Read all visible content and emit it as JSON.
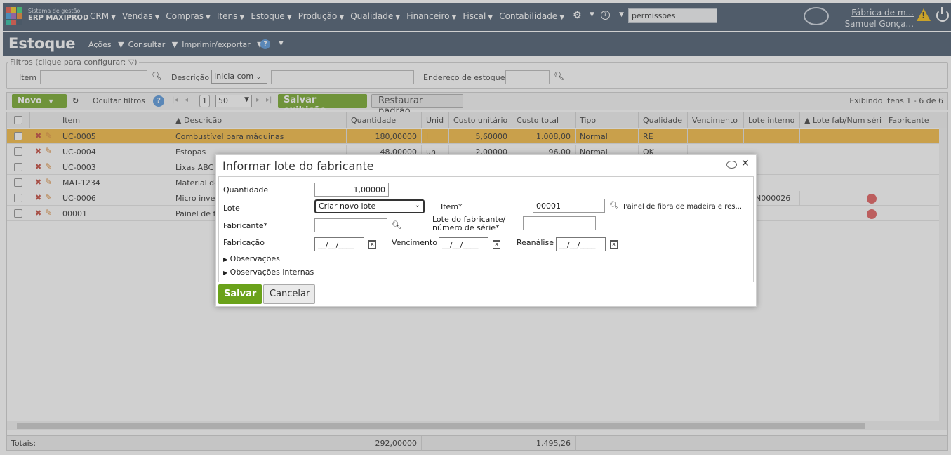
{
  "topbar": {
    "brand_line1": "Sistema de gestão",
    "brand_line2": "ERP MAXIPROD",
    "menu": [
      "CRM",
      "Vendas",
      "Compras",
      "Itens",
      "Estoque",
      "Produção",
      "Qualidade",
      "Financeiro",
      "Fiscal",
      "Contabilidade"
    ],
    "search_value": "permissões",
    "company": "Fábrica de m...",
    "user": "Samuel Gonça..."
  },
  "titlebar": {
    "title": "Estoque",
    "menu": [
      "Ações",
      "Consultar",
      "Imprimir/exportar"
    ]
  },
  "filters": {
    "legend": "Filtros (clique para configurar:",
    "item_label": "Item",
    "descricao_label": "Descrição",
    "descricao_mode": "Inicia com",
    "endereco_label": "Endereço de estoque"
  },
  "toolbar": {
    "novo": "Novo",
    "ocultar_filtros": "Ocultar filtros",
    "page_number": "1",
    "page_size": "50",
    "salvar_exibicao": "Salvar exibição",
    "restaurar_padrao": "Restaurar padrão",
    "exibindo": "Exibindo itens 1 - 6 de 6"
  },
  "grid": {
    "columns": [
      "Item",
      "Descrição",
      "Quantidade",
      "Unid",
      "Custo unitário",
      "Custo total",
      "Tipo",
      "Qualidade",
      "Vencimento",
      "Lote interno",
      "Lote fab/Num séri",
      "Fabricante"
    ],
    "rows": [
      {
        "item": "UC-0005",
        "descricao": "Combustível para máquinas",
        "quantidade": "180,00000",
        "unid": "l",
        "custo_unitario": "5,60000",
        "custo_total": "1.008,00",
        "tipo": "Normal",
        "qualidade": "RE",
        "lote_interno": "",
        "selected": true
      },
      {
        "item": "UC-0004",
        "descricao": "Estopas",
        "quantidade": "48,00000",
        "unid": "un",
        "custo_unitario": "2,00000",
        "custo_total": "96,00",
        "tipo": "Normal",
        "qualidade": "OK",
        "lote_interno": ""
      },
      {
        "item": "UC-0003",
        "descricao": "Lixas ABC",
        "quantidade": "",
        "unid": "",
        "custo_unitario": "",
        "custo_total": "",
        "tipo": "",
        "qualidade": "",
        "lote_interno": ""
      },
      {
        "item": "MAT-1234",
        "descricao": "Material de",
        "quantidade": "",
        "unid": "",
        "custo_unitario": "",
        "custo_total": "",
        "tipo": "",
        "qualidade": "",
        "lote_interno": ""
      },
      {
        "item": "UC-0006",
        "descricao": "Micro inver",
        "quantidade": "",
        "unid": "",
        "custo_unitario": "",
        "custo_total": "",
        "tipo": "",
        "qualidade": "",
        "lote_interno": "N000026"
      },
      {
        "item": "00001",
        "descricao": "Painel de f",
        "quantidade": "",
        "unid": "",
        "custo_unitario": "",
        "custo_total": "",
        "tipo": "",
        "qualidade": "",
        "lote_interno": ""
      }
    ],
    "totals_label": "Totais:",
    "total_quantidade": "292,00000",
    "total_custo": "1.495,26"
  },
  "dialog": {
    "title": "Informar lote do fabricante",
    "quantidade_label": "Quantidade",
    "quantidade_value": "1,00000",
    "lote_label": "Lote",
    "lote_value": "Criar novo lote",
    "item_label": "Item*",
    "item_value": "00001",
    "item_desc": "Painel de fibra de madeira e res...",
    "fabricante_label": "Fabricante*",
    "lote_fab_label_1": "Lote do fabricante/",
    "lote_fab_label_2": "número de série*",
    "fabricacao_label": "Fabricação",
    "vencimento_label": "Vencimento",
    "reanalise_label": "Reanálise",
    "date_placeholder": "__/__/____",
    "observacoes": "Observações",
    "observacoes_internas": "Observações internas",
    "salvar": "Salvar",
    "cancelar": "Cancelar"
  },
  "colors": {
    "nav_bg": "#3b4d63",
    "green_button": "#6aa21a",
    "selected_row": "#f4b533"
  }
}
